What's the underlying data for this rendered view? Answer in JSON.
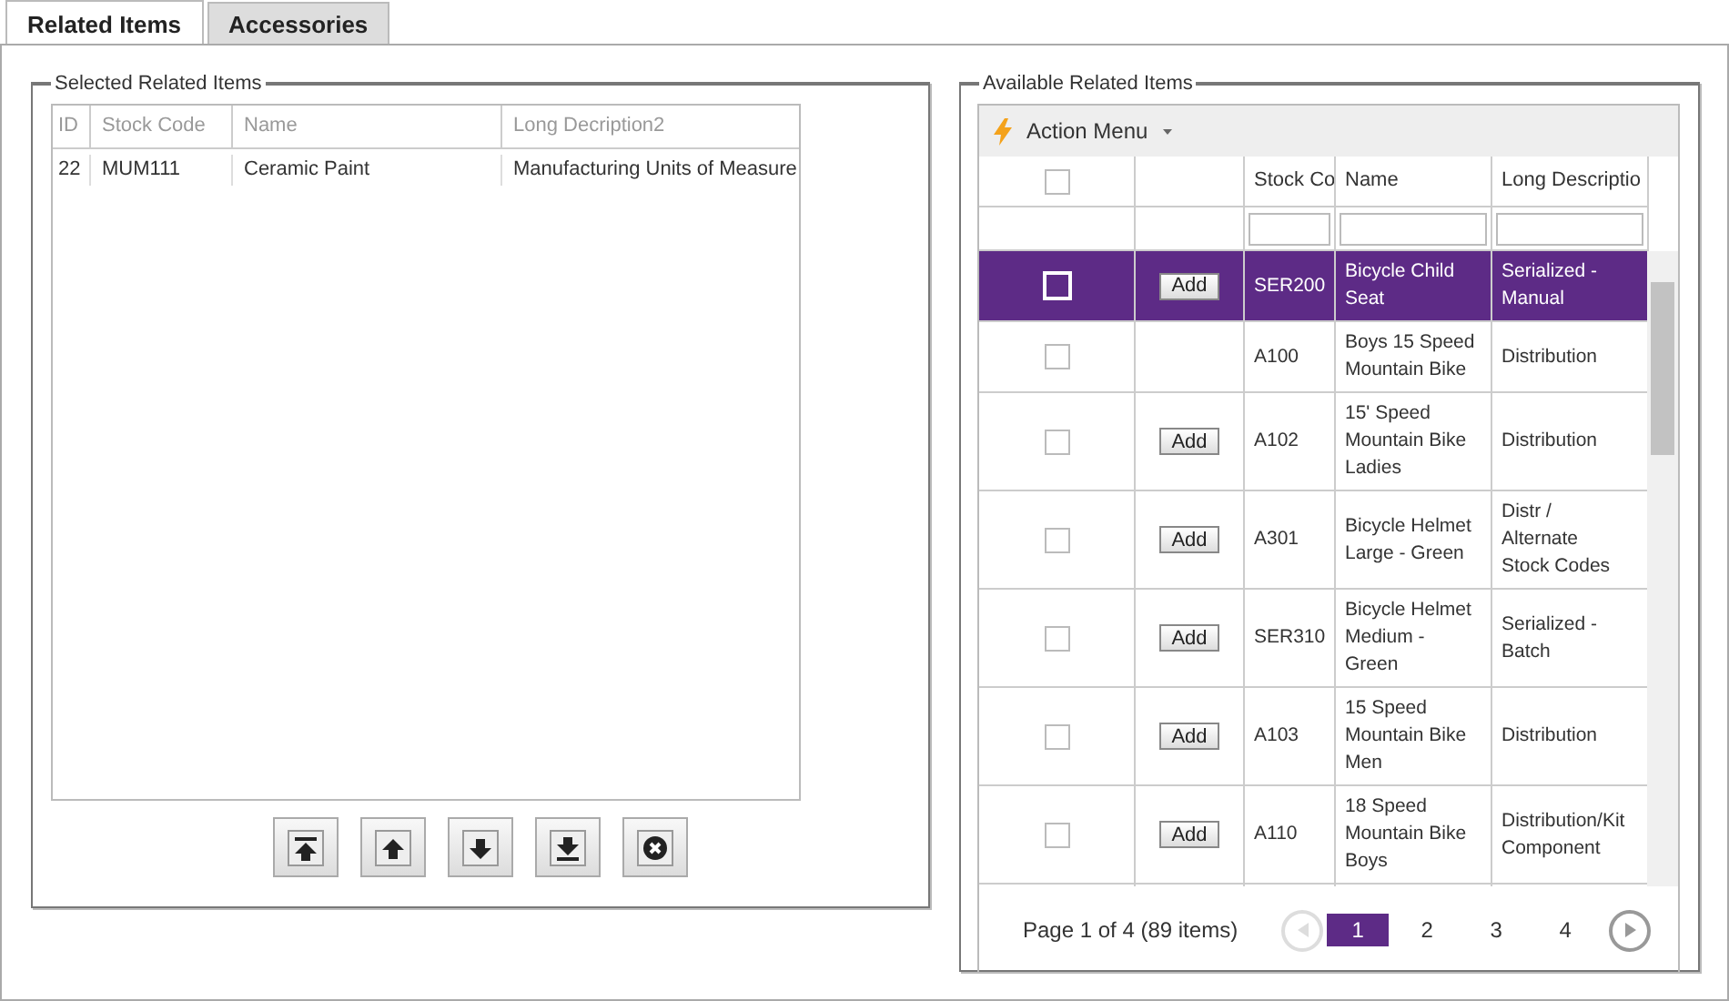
{
  "tabs": [
    {
      "label": "Related Items",
      "selected": true
    },
    {
      "label": "Accessories",
      "selected": false
    }
  ],
  "selected_items": {
    "legend": "Selected Related Items",
    "columns": [
      "ID",
      "Stock Code",
      "Name",
      "Long Decription2"
    ],
    "rows": [
      [
        "22",
        "MUM111",
        "Ceramic Paint",
        "Manufacturing Units of Measure"
      ]
    ]
  },
  "available_items": {
    "legend": "Available Related Items",
    "action_menu": "Action Menu",
    "columns": [
      "Stock Co",
      "Name",
      "Long Descriptio"
    ],
    "header_checked": false,
    "rows": [
      {
        "selected": true,
        "checked": false,
        "add": "Add",
        "stock_code": "SER200",
        "name": "Bicycle Child Seat",
        "description": "Serialized - Manual"
      },
      {
        "selected": false,
        "checked": false,
        "stock_code": "A100",
        "name": "Boys 15 Speed Mountain Bike",
        "description": "Distribution"
      },
      {
        "selected": false,
        "checked": false,
        "add": "Add",
        "stock_code": "A102",
        "name": "15' Speed Mountain Bike Ladies",
        "description": "Distribution"
      },
      {
        "selected": false,
        "checked": false,
        "add": "Add",
        "stock_code": "A301",
        "name": "Bicycle Helmet Large - Green",
        "description": "Distr / Alternate Stock Codes"
      },
      {
        "selected": false,
        "checked": false,
        "add": "Add",
        "stock_code": "SER310",
        "name": "Bicycle Helmet Medium - Green",
        "description": "Serialized - Batch"
      },
      {
        "selected": false,
        "checked": false,
        "add": "Add",
        "stock_code": "A103",
        "name": "15 Speed Mountain Bike Men",
        "description": "Distribution"
      },
      {
        "selected": false,
        "checked": false,
        "add": "Add",
        "stock_code": "A110",
        "name": "18 Speed Mountain Bike Boys",
        "description": "Distribution/Kit Component"
      }
    ],
    "pager": {
      "summary": "Page 1 of 4 (89 items)",
      "prev_disabled": true,
      "next_disabled": false,
      "pages": [
        {
          "label": "1",
          "selected": true
        },
        {
          "label": "2",
          "selected": false
        },
        {
          "label": "3",
          "selected": false
        },
        {
          "label": "4",
          "selected": false
        }
      ]
    }
  }
}
